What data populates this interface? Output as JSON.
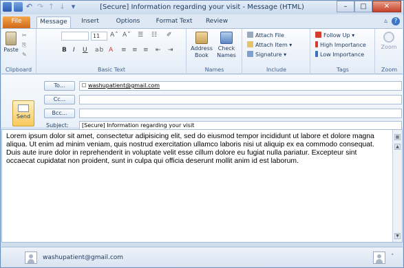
{
  "window": {
    "title": "[Secure] Information regarding your visit - Message (HTML)"
  },
  "controls": {
    "minimize": "–",
    "maximize": "□",
    "close": "✕"
  },
  "tabs": [
    "File",
    "Message",
    "Insert",
    "Options",
    "Format Text",
    "Review"
  ],
  "ribbon": {
    "clipboard": {
      "label": "Clipboard",
      "paste": "Paste"
    },
    "basic_text": {
      "label": "Basic Text",
      "font_size": "11"
    },
    "names": {
      "label": "Names",
      "address_book": "Address Book",
      "check_names": "Check Names"
    },
    "include": {
      "label": "Include",
      "attach_file": "Attach File",
      "attach_item": "Attach Item",
      "signature": "Signature"
    },
    "tags": {
      "label": "Tags",
      "follow_up": "Follow Up",
      "high_importance": "High Importance",
      "low_importance": "Low Importance"
    },
    "zoom": {
      "label": "Zoom",
      "zoom_btn": "Zoom"
    }
  },
  "form": {
    "send": "Send",
    "to_btn": "To...",
    "cc_btn": "Cc...",
    "bcc_btn": "Bcc...",
    "to_value": "washupatient@gmail.com",
    "subject_label": "Subject:",
    "subject_value": "[Secure] Information regarding your visit"
  },
  "body_text": "Lorem ipsum dolor sit amet, consectetur adipisicing elit, sed do eiusmod tempor incididunt ut labore et dolore magna aliqua. Ut enim ad minim veniam, quis nostrud exercitation ullamco laboris nisi ut aliquip ex ea commodo consequat. Duis aute irure dolor in reprehenderit in voluptate velit esse cillum dolore eu fugiat nulla pariatur. Excepteur sint occaecat cupidatat non proident, sunt in culpa qui officia deserunt mollit anim id est laborum.",
  "people_pane": {
    "name": "washupatient@gmail.com"
  }
}
